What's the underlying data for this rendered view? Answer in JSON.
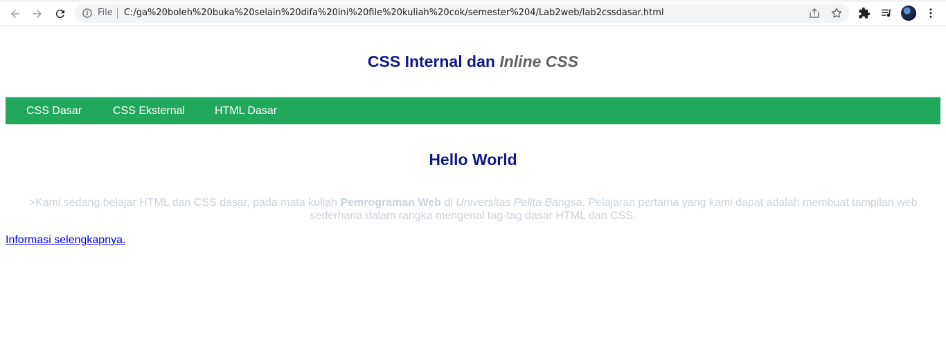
{
  "browser": {
    "file_label": "File",
    "url": "C:/ga%20boleh%20buka%20selain%20difa%20ini%20file%20kuliah%20cok/semester%204/Lab2web/lab2cssdasar.html"
  },
  "header": {
    "title_part1": "CSS Internal dan ",
    "title_part2": "Inline CSS"
  },
  "navbar": {
    "items": [
      "CSS Dasar",
      "CSS Eksternal",
      "HTML Dasar"
    ]
  },
  "content": {
    "heading": "Hello World",
    "para_part1": ">Kami sedang belajar HTML dan CSS dasar, pada mata kuliah ",
    "para_bold": "Pemrograman Web",
    "para_part2": " di ",
    "para_italic": "Universitas Pelita Bangsa",
    "para_part3": ". Pelajaran pertama yang kami dapat adalah membuat tampilan web sederhana dalam rangka mengenal tag-tag dasar HTML dan CSS.",
    "link": "Informasi selengkapnya."
  },
  "colors": {
    "heading": "#13178a",
    "navbar": "#22a85a",
    "paragraph": "#c9d2dc",
    "link": "#0000ee"
  }
}
